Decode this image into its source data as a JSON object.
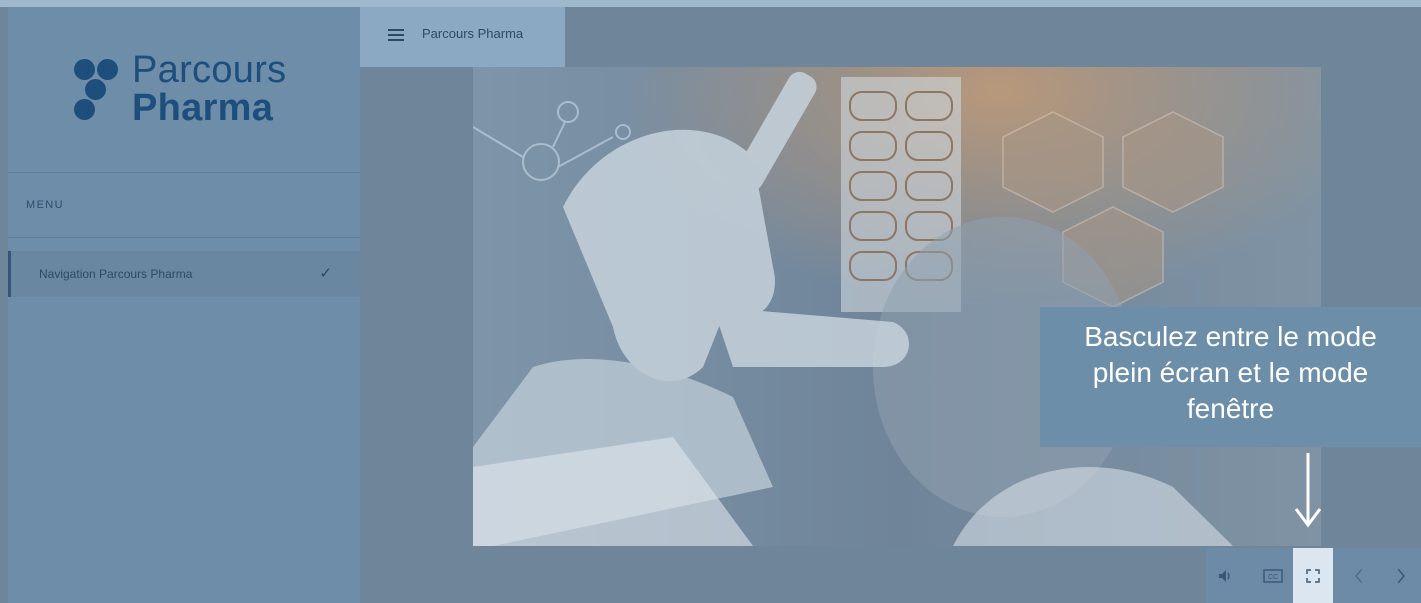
{
  "brand": {
    "line1": "Parcours",
    "line2": "Pharma"
  },
  "sidebar": {
    "menu_label": "MENU",
    "items": [
      {
        "label": "Navigation Parcours Pharma",
        "status_icon": "checkmark-icon"
      }
    ]
  },
  "header": {
    "menu_icon": "hamburger-menu-icon",
    "title": "Parcours Pharma"
  },
  "tooltip": {
    "lines": [
      "Basculez entre le mode",
      "plein écran et le mode",
      "fenêtre"
    ]
  },
  "controls": {
    "items": [
      {
        "icon": "volume-icon"
      },
      {
        "icon": "closed-captions-icon",
        "label": "CC"
      },
      {
        "icon": "fullscreen-icon",
        "active": true
      },
      {
        "icon": "previous-icon"
      },
      {
        "icon": "next-icon"
      }
    ]
  },
  "colors": {
    "brand_blue": "#1e4e7c",
    "tooltip_bg": "#6d8ea9"
  }
}
